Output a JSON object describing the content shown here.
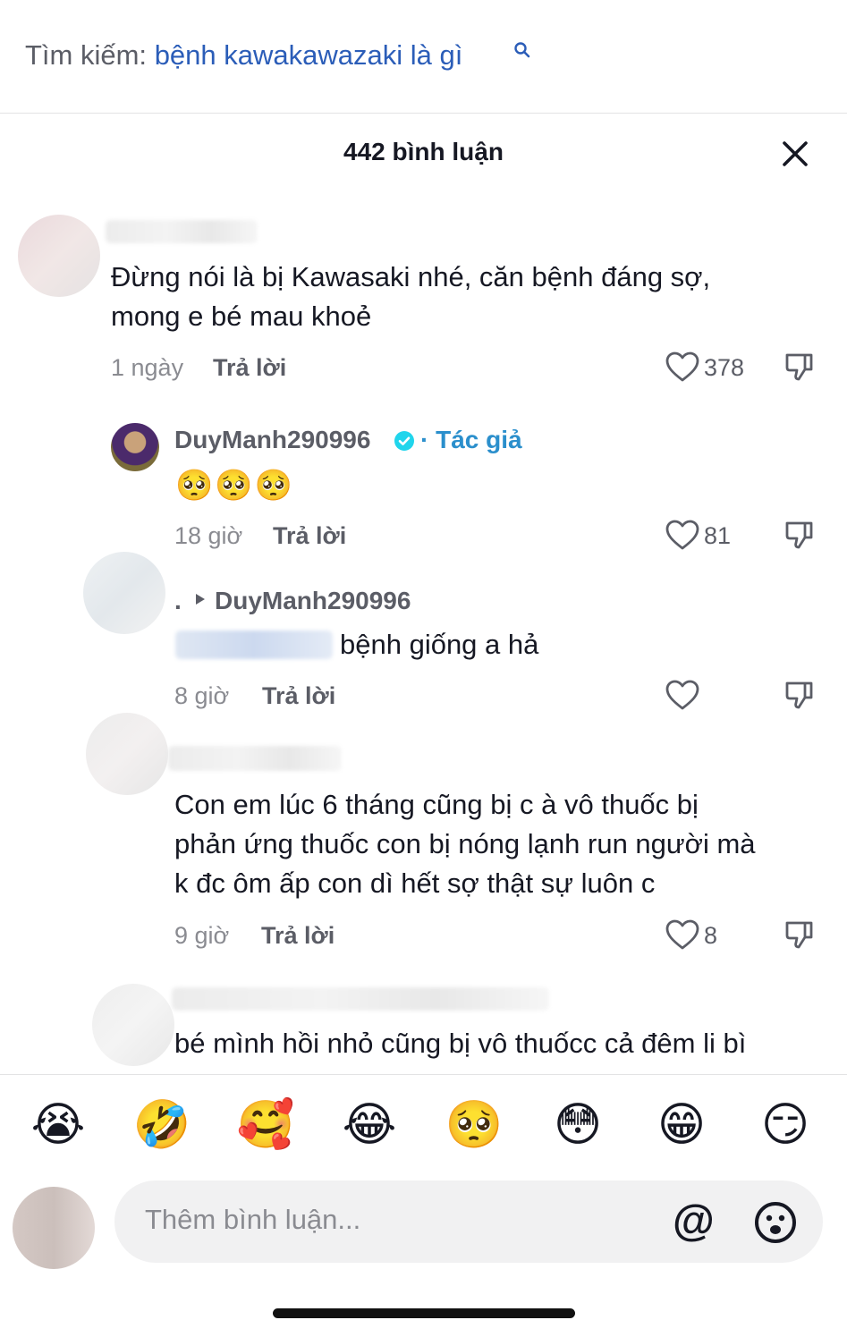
{
  "search": {
    "prefix": "Tìm kiếm:",
    "query": "bệnh kawakawazaki là gì"
  },
  "header": {
    "title": "442 bình luận"
  },
  "comments": [
    {
      "text_line1": "Đừng nói là bị Kawasaki nhé, căn bệnh đáng sợ,",
      "text_line2": "mong e bé mau khoẻ",
      "time": "1 ngày",
      "reply": "Trả lời",
      "likes": "378"
    },
    {
      "author": "DuyManh290996",
      "author_tag": "· Tác giả",
      "emojis": "🥺🥺🥺",
      "time": "18 giờ",
      "reply": "Trả lời",
      "likes": "81"
    },
    {
      "dot": ".",
      "reply_to": "DuyManh290996",
      "text": "bệnh giống a hả",
      "time": "8 giờ",
      "reply": "Trả lời",
      "likes": ""
    },
    {
      "text_line1": "Con em lúc 6 tháng cũng bị c à vô thuốc bị",
      "text_line2": "phản ứng thuốc con bị nóng lạnh run người mà",
      "text_line3": "k đc ôm ấp con dì hết sợ thật sự luôn c",
      "time": "9 giờ",
      "reply": "Trả lời",
      "likes": "8"
    },
    {
      "text_line1": "bé mình hồi nhỏ cũng bị vô thuốcc cả đêm li bì"
    }
  ],
  "emoji_bar": [
    "😭",
    "🤣",
    "🥰",
    "😂",
    "🥺",
    "😳",
    "😁",
    "😏"
  ],
  "input": {
    "placeholder": "Thêm bình luận...",
    "at": "@"
  },
  "colors": {
    "link_blue": "#2b5db8",
    "author_tag": "#2b8fcc",
    "verified": "#20d5ec"
  }
}
